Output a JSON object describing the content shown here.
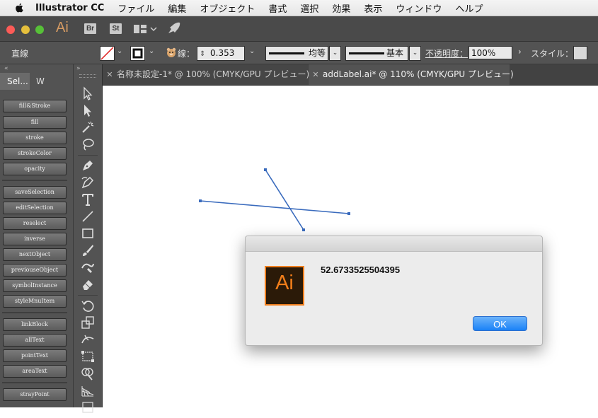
{
  "menubar": {
    "app_name": "Illustrator CC",
    "items": [
      "ファイル",
      "編集",
      "オブジェクト",
      "書式",
      "選択",
      "効果",
      "表示",
      "ウィンドウ",
      "ヘルプ"
    ]
  },
  "apptitle": {
    "logo": "Ai",
    "bridge": "Br",
    "stock": "St"
  },
  "control": {
    "selection_type": "直線",
    "stroke_label": "線：",
    "stroke_weight": "0.353 m",
    "profile": "均等",
    "brush": "基本",
    "opacity_label": "不透明度：",
    "opacity_value": "100%",
    "style_label": "スタイル："
  },
  "panel": {
    "tab_selection": "Sel...",
    "tab_w": "W",
    "buttons": [
      "fill&Stroke",
      "fill",
      "stroke",
      "strokeColor",
      "opacity",
      "saveSelection",
      "editSelection",
      "reselect",
      "inverse",
      "nextObject",
      "previouseObject",
      "symbolInstance",
      "styleMnuItem",
      "linkBlock",
      "allText",
      "pointText",
      "areaText",
      "strayPoint"
    ]
  },
  "tabs": [
    {
      "label": "名称未設定-1* @ 100% (CMYK/GPU プレビュー)"
    },
    {
      "label": "addLabel.ai* @ 110% (CMYK/GPU プレビュー)"
    }
  ],
  "dialog": {
    "icon_text": "Ai",
    "message": "52.6733525504395",
    "ok_label": "OK"
  },
  "colors": {
    "line": "#3a6bbd",
    "ok_button": "#1a82f7",
    "ai_orange": "#f27e1a"
  }
}
